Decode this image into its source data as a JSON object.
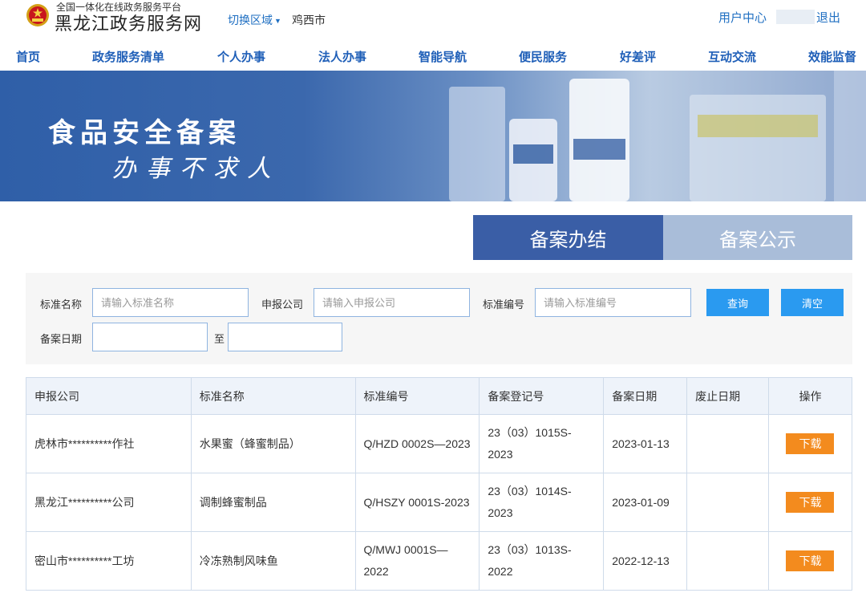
{
  "header": {
    "platform_subtitle": "全国一体化在线政务服务平台",
    "platform_title": "黑龙江政务服务网",
    "region_switch": "切换区域",
    "region_city": "鸡西市",
    "user_center": "用户中心",
    "logout": "退出"
  },
  "nav": {
    "items": [
      "首页",
      "政务服务清单",
      "个人办事",
      "法人办事",
      "智能导航",
      "便民服务",
      "好差评",
      "互动交流",
      "效能监督"
    ]
  },
  "banner": {
    "title": "食品安全备案",
    "slogan": "办事不求人"
  },
  "tabs": {
    "active": "备案办结",
    "inactive": "备案公示"
  },
  "search": {
    "std_name_label": "标准名称",
    "std_name_placeholder": "请输入标准名称",
    "company_label": "申报公司",
    "company_placeholder": "请输入申报公司",
    "std_no_label": "标准编号",
    "std_no_placeholder": "请输入标准编号",
    "query_button": "查询",
    "clear_button": "清空",
    "date_label": "备案日期",
    "date_to": "至"
  },
  "table": {
    "headers": [
      "申报公司",
      "标准名称",
      "标准编号",
      "备案登记号",
      "备案日期",
      "废止日期",
      "操作"
    ],
    "rows": [
      {
        "company": "虎林市**********作社",
        "std_name": "水果蜜（蜂蜜制品）",
        "std_no": "Q/HZD 0002S—2023",
        "reg_no": "23（03）1015S-2023",
        "date": "2023-01-13",
        "void_date": "",
        "action": "下载"
      },
      {
        "company": "黑龙江**********公司",
        "std_name": "调制蜂蜜制品",
        "std_no": "Q/HSZY 0001S-2023",
        "reg_no": "23（03）1014S-2023",
        "date": "2023-01-09",
        "void_date": "",
        "action": "下载"
      },
      {
        "company": "密山市**********工坊",
        "std_name": "冷冻熟制风味鱼",
        "std_no": "Q/MWJ 0001S—2022",
        "reg_no": "23（03）1013S-2022",
        "date": "2022-12-13",
        "void_date": "",
        "action": "下载"
      }
    ]
  },
  "colors": {
    "nav_text": "#1f5fb8",
    "tab_active": "#3a5ea6",
    "tab_inactive": "#a9bdd9",
    "button_blue": "#2a9af0",
    "download_orange": "#f38b1e"
  }
}
